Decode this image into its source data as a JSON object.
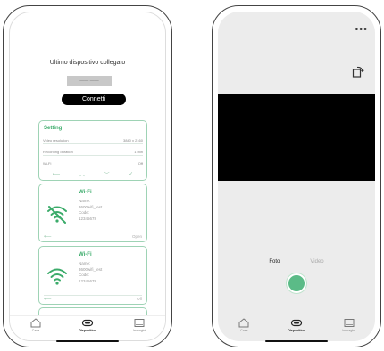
{
  "screen1": {
    "title": "Ultimo dispositivo collegato",
    "device_box": "——  ——",
    "connect_label": "Connetti",
    "settings": {
      "title": "Setting",
      "rows": [
        {
          "label": "Video resolution",
          "value": "3840 x 2160"
        },
        {
          "label": "Recording duration",
          "value": "1 min"
        },
        {
          "label": "Wi-Fi",
          "value": "Off"
        }
      ],
      "controls": [
        "⟵",
        "︿",
        "﹀",
        "✓"
      ]
    },
    "wifi_cards": [
      {
        "title": "Wi-Fi",
        "details": [
          "Name:",
          "3600wifi_test",
          "Code:",
          "12345678"
        ],
        "status": "Open",
        "icon": "wifi-off-icon"
      },
      {
        "title": "Wi-Fi",
        "details": [
          "Name:",
          "3600wifi_test",
          "Code:",
          "12345678"
        ],
        "status": "Off",
        "icon": "wifi-icon"
      }
    ],
    "partial_card_text": "——— ≡",
    "nav": [
      {
        "label": "Casa",
        "icon": "home-icon"
      },
      {
        "label": "Dispositivo",
        "icon": "device-icon"
      },
      {
        "label": "Immagini",
        "icon": "gallery-icon"
      }
    ]
  },
  "screen2": {
    "more_icon": "•••",
    "rotate_icon": "rotate-icon",
    "modes": {
      "foto": "Foto",
      "video": "Video"
    },
    "accent": "#5bbb87",
    "nav": [
      {
        "label": "Casa",
        "icon": "home-icon"
      },
      {
        "label": "Dispositivo",
        "icon": "device-icon"
      },
      {
        "label": "Immagini",
        "icon": "gallery-icon"
      }
    ]
  }
}
